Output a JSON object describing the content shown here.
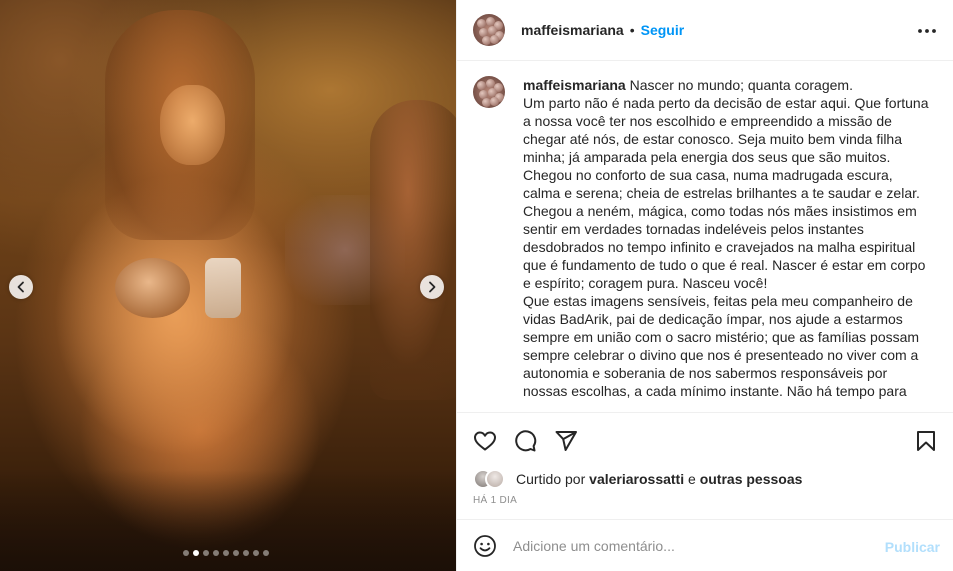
{
  "post": {
    "author": "maffeismariana",
    "separator": "•",
    "follow_label": "Seguir",
    "photo_alt": "Mãe nua sentada no chão segurando recém-nascida, com uma criança ao lado, sob luz quente",
    "carousel": {
      "count": 9,
      "active_index": 1
    }
  },
  "caption": {
    "username": "maffeismariana",
    "text": "Nascer no mundo; quanta coragem.\nUm parto não é nada perto da decisão de estar aqui. Que fortuna a nossa você ter nos escolhido e empreendido a missão de chegar até nós, de estar conosco. Seja muito bem vinda filha minha; já amparada pela energia dos seus que são muitos. Chegou no conforto de sua casa, numa madrugada escura, calma e serena; cheia de estrelas brilhantes a te saudar e zelar. Chegou a neném, mágica, como todas nós mães insistimos em sentir em verdades tornadas indeléveis pelos instantes desdobrados no tempo infinito e cravejados na malha espiritual que é fundamento de tudo o que é real. Nascer é estar em corpo e espírito; coragem pura. Nasceu você!\nQue estas imagens sensíveis, feitas pela meu companheiro de vidas BadArik, pai de dedicação ímpar, nos ajude a estarmos sempre em união com o sacro mistério; que as famílias possam sempre celebrar o divino que nos é presenteado no viver com a autonomia e soberania de nos sabermos responsáveis por nossas escolhas, a cada mínimo instante. Não há tempo para"
  },
  "likes": {
    "prefix": "Curtido por",
    "user": "valeriarossatti",
    "connector": "e",
    "others": "outras pessoas"
  },
  "timestamp": "HÁ 1 DIA",
  "comment_box": {
    "placeholder": "Adicione um comentário...",
    "publish_label": "Publicar"
  },
  "colors": {
    "accent": "#0095f6",
    "publish_disabled": "#b2dffc",
    "muted": "#8e8e8e",
    "text": "#262626",
    "divider": "#efefef"
  },
  "icons": {
    "prev": "chevron-left-icon",
    "next": "chevron-right-icon",
    "more": "more-horizontal-icon",
    "like": "heart-icon",
    "comment": "comment-icon",
    "share": "paper-plane-icon",
    "save": "bookmark-icon",
    "emoji": "smiley-icon"
  }
}
